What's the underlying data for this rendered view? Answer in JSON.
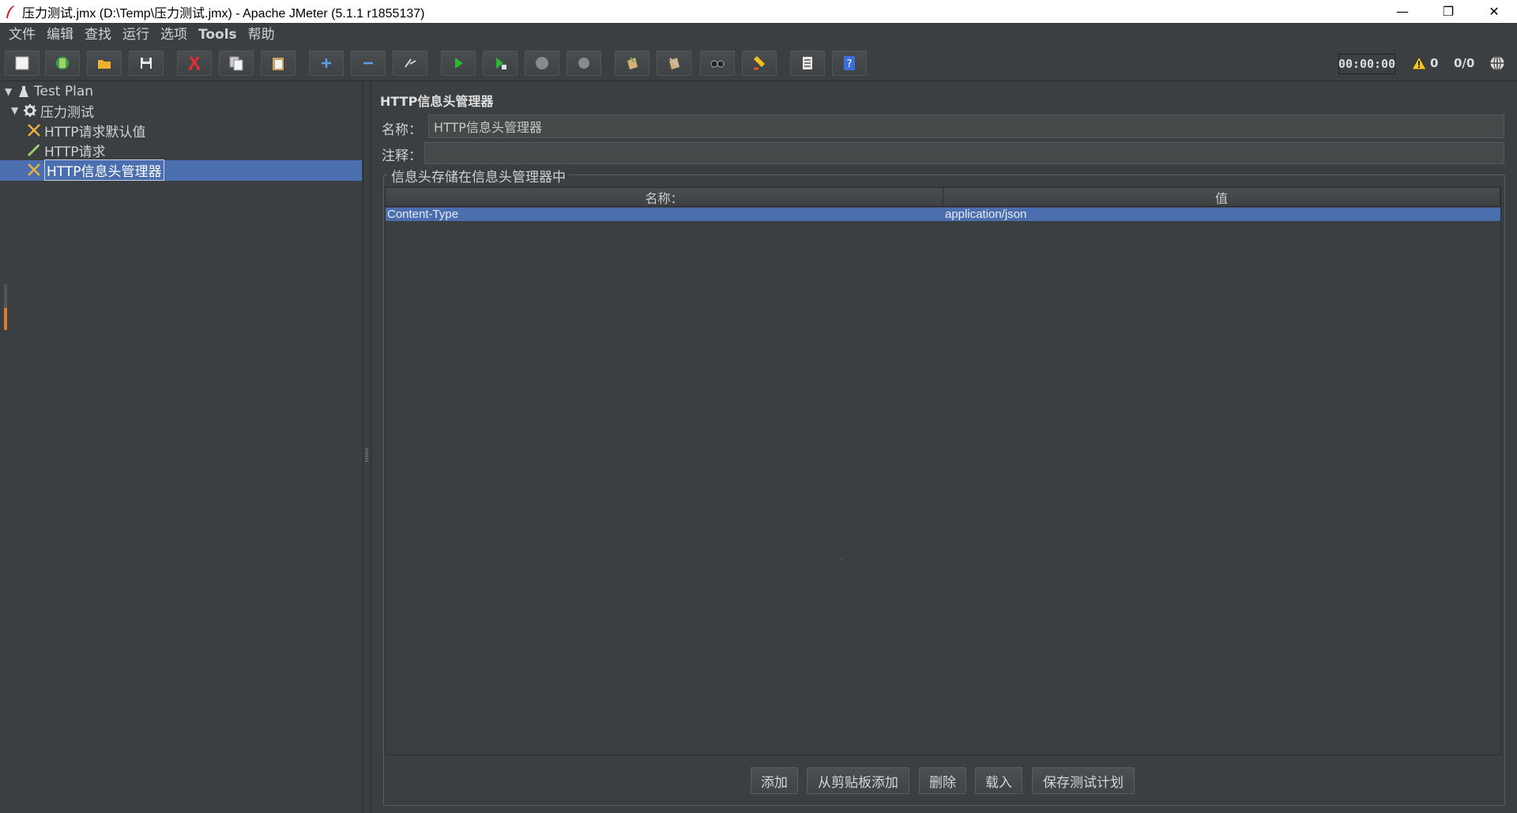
{
  "window": {
    "title": "压力测试.jmx (D:\\Temp\\压力测试.jmx) - Apache JMeter (5.1.1 r1855137)",
    "minimize": "—",
    "maximize": "❐",
    "close": "✕"
  },
  "menu": [
    "文件",
    "编辑",
    "查找",
    "运行",
    "选项",
    "Tools",
    "帮助"
  ],
  "toolbar": {
    "buttons": [
      "new-icon",
      "templates-icon",
      "open-icon",
      "save-icon",
      "cut-icon",
      "copy-icon",
      "paste-icon",
      "expand-icon",
      "collapse-icon",
      "toggle-icon",
      "start-icon",
      "start-no-pause-icon",
      "stop-icon",
      "shutdown-icon",
      "clear-icon",
      "clear-all-icon",
      "search-icon",
      "reset-search-icon",
      "function-helper-icon",
      "help-icon"
    ],
    "timer": "00:00:00",
    "warning_count": "0",
    "threads": "0/0"
  },
  "tree": {
    "items": [
      {
        "label": "Test Plan",
        "icon": "test-plan-icon",
        "expanded": true
      },
      {
        "label": "压力测试",
        "icon": "thread-group-icon",
        "expanded": true
      },
      {
        "label": "HTTP请求默认值",
        "icon": "config-element-icon"
      },
      {
        "label": "HTTP请求",
        "icon": "sampler-icon"
      },
      {
        "label": "HTTP信息头管理器",
        "icon": "config-element-icon",
        "selected": true
      }
    ]
  },
  "editor": {
    "title": "HTTP信息头管理器",
    "name_label": "名称：",
    "name_value": "HTTP信息头管理器",
    "comment_label": "注释：",
    "comment_value": "",
    "group_title": "信息头存储在信息头管理器中",
    "table": {
      "columns": [
        "名称：",
        "值"
      ],
      "rows": [
        {
          "name": "Content-Type",
          "value": "application/json",
          "selected": true
        }
      ]
    },
    "buttons": {
      "add": "添加",
      "add_from_clipboard": "从剪贴板添加",
      "delete": "删除",
      "load": "载入",
      "save_test_plan": "保存测试计划"
    }
  },
  "colors": {
    "background": "#3c3f41",
    "selection": "#4b6eaf",
    "input_bg": "#45494a"
  }
}
